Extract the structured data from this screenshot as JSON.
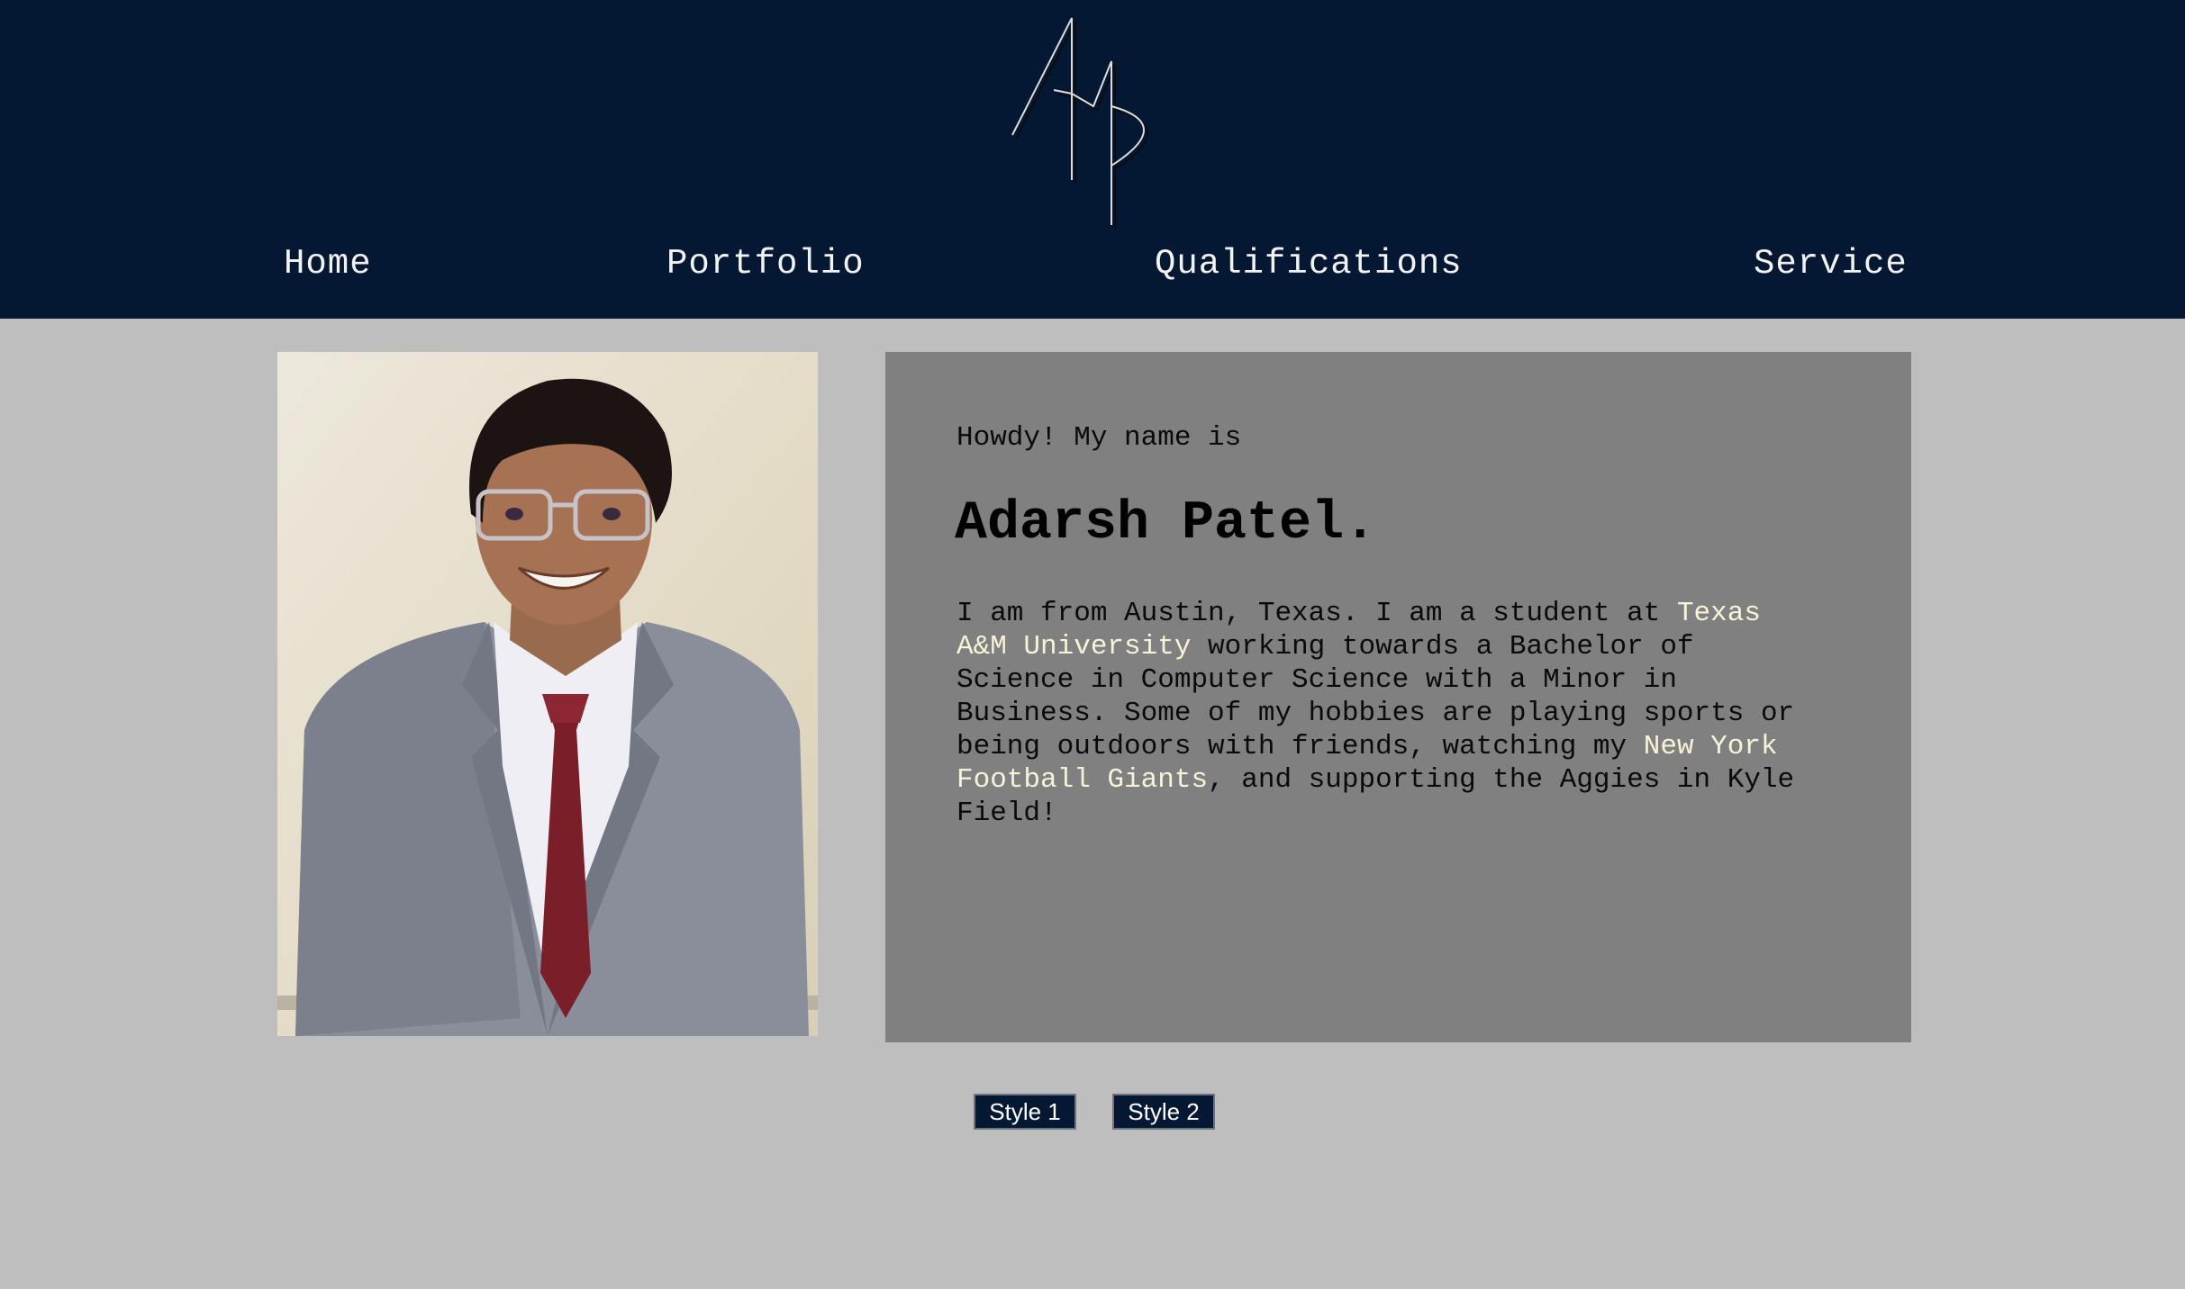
{
  "header": {
    "logo_text": "AMP",
    "background": "#041834",
    "nav": [
      {
        "label": "Home"
      },
      {
        "label": "Portfolio"
      },
      {
        "label": "Qualifications"
      },
      {
        "label": "Service"
      }
    ]
  },
  "profile": {
    "photo_icon": "portrait-photo",
    "greeting": "Howdy! My name is",
    "name": "Adarsh Patel.",
    "bio": {
      "line1_a": "I am from Austin, Texas. I am a student at ",
      "line1_link": "Texas",
      "line2_link": "A&M University",
      "line2_b": " working towards a Bachelor of",
      "line3": "Science in Computer Science with a Minor in",
      "line4": "Business. Some of my hobbies are playing sports or",
      "line5_a": "being outdoors with friends, watching my ",
      "line5_link": "New York",
      "line6_link": "Football Giants",
      "line6_b": ", and supporting the Aggies in Kyle",
      "line7": "Field!"
    },
    "highlight_color": "#f7f2d8"
  },
  "style_buttons": [
    {
      "label": "Style 1"
    },
    {
      "label": "Style 2"
    }
  ]
}
